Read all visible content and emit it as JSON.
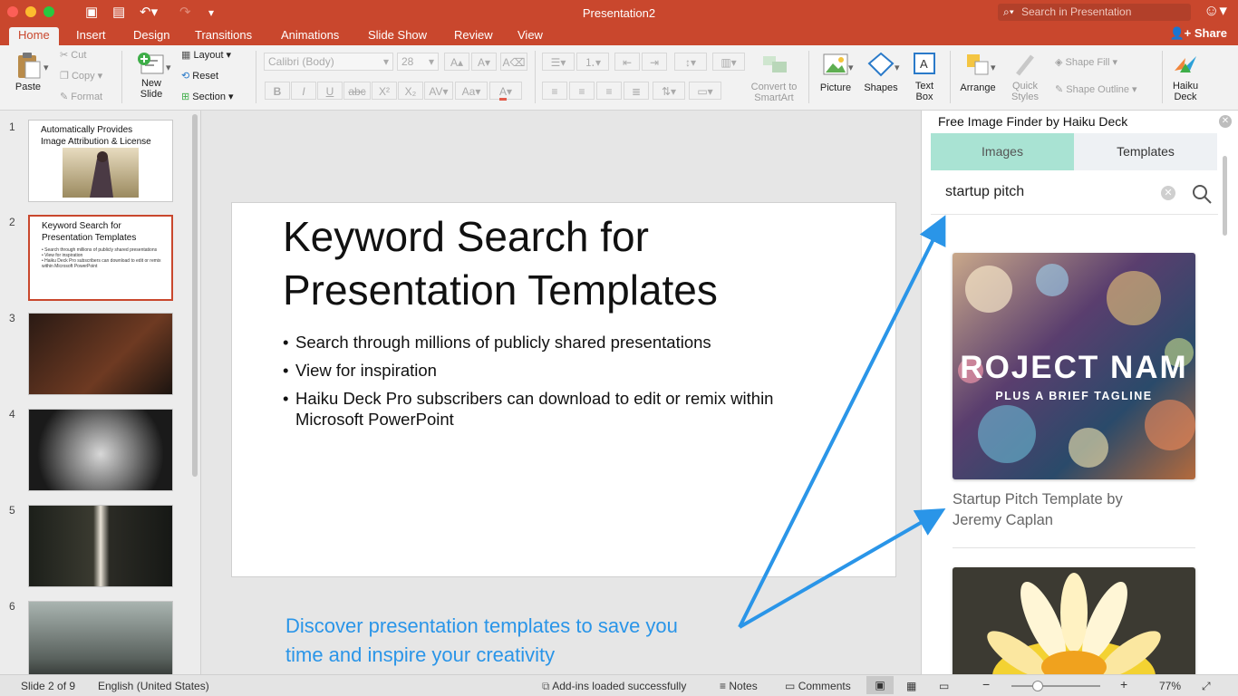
{
  "app": {
    "window_title": "Presentation2",
    "search_placeholder": "Search in Presentation",
    "share_label": "Share",
    "accent_color": "#c9472d"
  },
  "tabs": [
    "Home",
    "Insert",
    "Design",
    "Transitions",
    "Animations",
    "Slide Show",
    "Review",
    "View"
  ],
  "ribbon": {
    "paste": "Paste",
    "cut": "Cut",
    "copy": "Copy",
    "format": "Format",
    "new_slide": [
      "New",
      "Slide"
    ],
    "layout": "Layout",
    "reset": "Reset",
    "section": "Section",
    "font_name": "Calibri (Body)",
    "font_size": "28",
    "convert": [
      "Convert to",
      "SmartArt"
    ],
    "picture": "Picture",
    "shapes": "Shapes",
    "text_box": [
      "Text",
      "Box"
    ],
    "arrange": "Arrange",
    "quick_styles": [
      "Quick",
      "Styles"
    ],
    "shape_fill": "Shape Fill",
    "shape_outline": "Shape Outline",
    "haiku_deck": [
      "Haiku",
      "Deck"
    ]
  },
  "thumbnails": [
    {
      "num": "1",
      "title": [
        "Automatically Provides",
        "Image Attribution & License"
      ]
    },
    {
      "num": "2",
      "title": [
        "Keyword Search for",
        "Presentation Templates"
      ],
      "bullets": [
        "• Search through millions of publicly shared presentations",
        "• View for inspiration",
        "• Haiku Deck Pro subscribers can download to edit or remix within Microsoft PowerPoint"
      ]
    },
    {
      "num": "3"
    },
    {
      "num": "4"
    },
    {
      "num": "5"
    },
    {
      "num": "6"
    }
  ],
  "slide": {
    "title_lines": [
      "Keyword Search for",
      "Presentation Templates"
    ],
    "bullets": [
      "Search through millions of publicly shared presentations",
      "View for inspiration",
      "Haiku Deck Pro subscribers can download to edit or remix within Microsoft PowerPoint"
    ]
  },
  "callout": [
    "Discover presentation templates to save you",
    "time and inspire your creativity"
  ],
  "panel": {
    "title": "Free Image Finder by Haiku Deck",
    "tab_images": "Images",
    "tab_templates": "Templates",
    "search_value": "startup pitch",
    "card1_image_title": "ROJECT NAM",
    "card1_image_tagline": "PLUS A BRIEF TAGLINE",
    "card1_title": [
      "Startup Pitch Template by",
      "Jeremy Caplan"
    ]
  },
  "statusbar": {
    "slide_info": "Slide 2 of 9",
    "language": "English (United States)",
    "addins": "Add-ins loaded successfully",
    "notes": "Notes",
    "comments": "Comments",
    "zoom_minus": "−",
    "zoom_plus": "+",
    "zoom": "77%",
    "zoom_fraction": 0.3
  }
}
